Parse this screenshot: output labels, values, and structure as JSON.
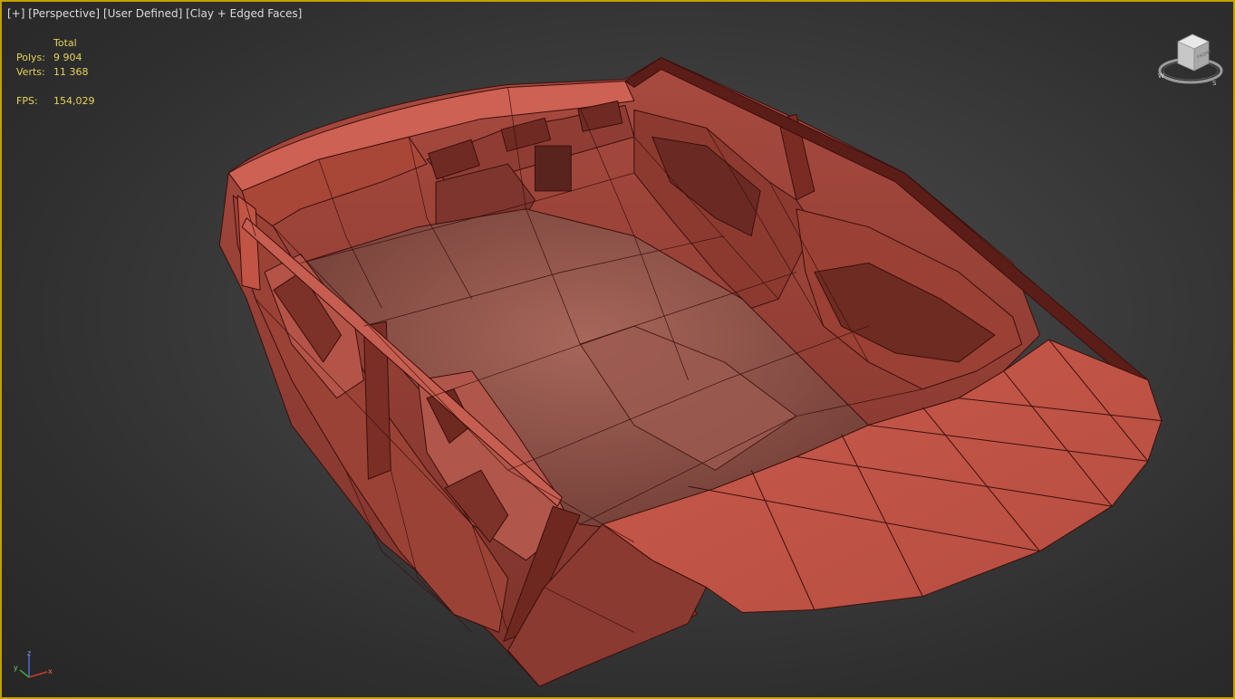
{
  "viewport": {
    "labels": {
      "menu": "[+]",
      "view": "[Perspective]",
      "camera": "[User Defined]",
      "shading": "[Clay + Edged Faces]"
    },
    "stats": {
      "header": "Total",
      "polys_label": "Polys:",
      "polys_value": "9 904",
      "verts_label": "Verts:",
      "verts_value": "11 368",
      "fps_label": "FPS:",
      "fps_value": "154,029"
    },
    "viewcube": {
      "face_label": "FRONT",
      "icon": "viewcube-icon"
    },
    "axis": {
      "x": "x",
      "y": "y",
      "z": "z"
    },
    "colors": {
      "active_border": "#c4a000",
      "stats_text": "#e6d35a",
      "clay": "#c0574a",
      "edge": "#3a0f0c"
    }
  }
}
